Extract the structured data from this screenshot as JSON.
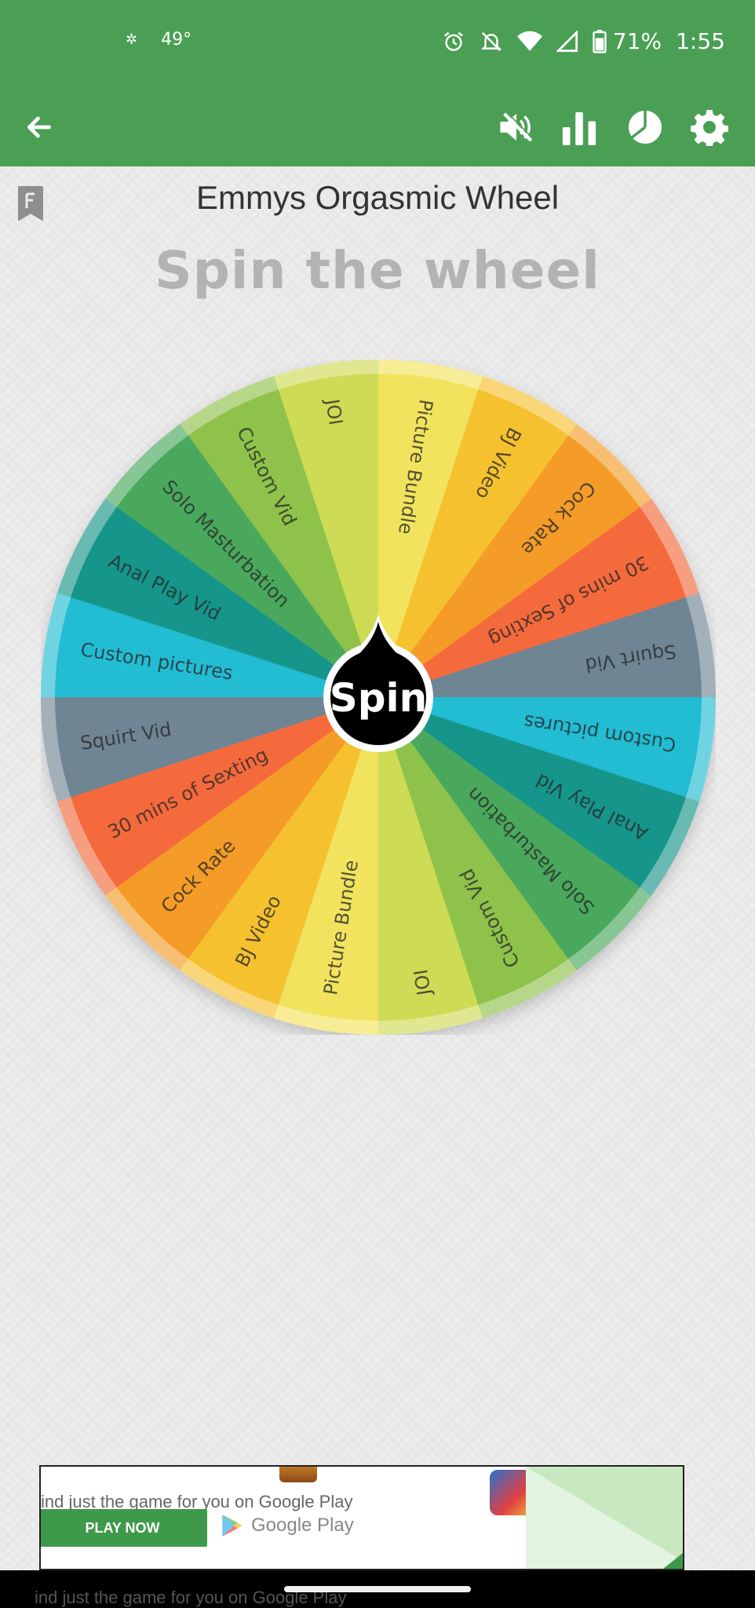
{
  "status_bar": {
    "weather_temp": "49°",
    "battery": "71%",
    "time": "1:55"
  },
  "toolbar": {
    "back_icon": "arrow-left-icon",
    "mute_icon": "volume-mute-icon",
    "stats_icon": "bar-chart-icon",
    "pie_icon": "pie-chart-icon",
    "settings_icon": "gear-icon"
  },
  "wheel": {
    "title": "Emmys Orgasmic Wheel",
    "header": "Spin the wheel",
    "spin_label": "Spin",
    "segments": [
      {
        "label": "Picture Bundle",
        "color": "#f1e35d"
      },
      {
        "label": "BJ Video",
        "color": "#f6c12f"
      },
      {
        "label": "Cock Rate",
        "color": "#f49c27"
      },
      {
        "label": "30 mins of Sexting",
        "color": "#f46a3c"
      },
      {
        "label": "Squirt Vid",
        "color": "#6f8594"
      },
      {
        "label": "Custom pictures",
        "color": "#22bcd3"
      },
      {
        "label": "Anal Play Vid",
        "color": "#16958a"
      },
      {
        "label": "Solo Masturbation",
        "color": "#49a85c"
      },
      {
        "label": "Custom Vid",
        "color": "#8ec24a"
      },
      {
        "label": "JOI",
        "color": "#cedb55"
      },
      {
        "label": "Picture Bundle",
        "color": "#f1e35d"
      },
      {
        "label": "BJ Video",
        "color": "#f6c12f"
      },
      {
        "label": "Cock Rate",
        "color": "#f49c27"
      },
      {
        "label": "30 mins of Sexting",
        "color": "#f46a3c"
      },
      {
        "label": "Squirt Vid",
        "color": "#6f8594"
      },
      {
        "label": "Custom pictures",
        "color": "#22bcd3"
      },
      {
        "label": "Anal Play Vid",
        "color": "#16958a"
      },
      {
        "label": "Solo Masturbation",
        "color": "#49a85c"
      },
      {
        "label": "Custom Vid",
        "color": "#8ec24a"
      },
      {
        "label": "JOI",
        "color": "#cedb55"
      }
    ]
  },
  "ad": {
    "text": "ind just the game for you on Google Play",
    "button": "PLAY NOW",
    "store": "Google Play",
    "ghost_text": "ind just the game for you on Google Play"
  }
}
